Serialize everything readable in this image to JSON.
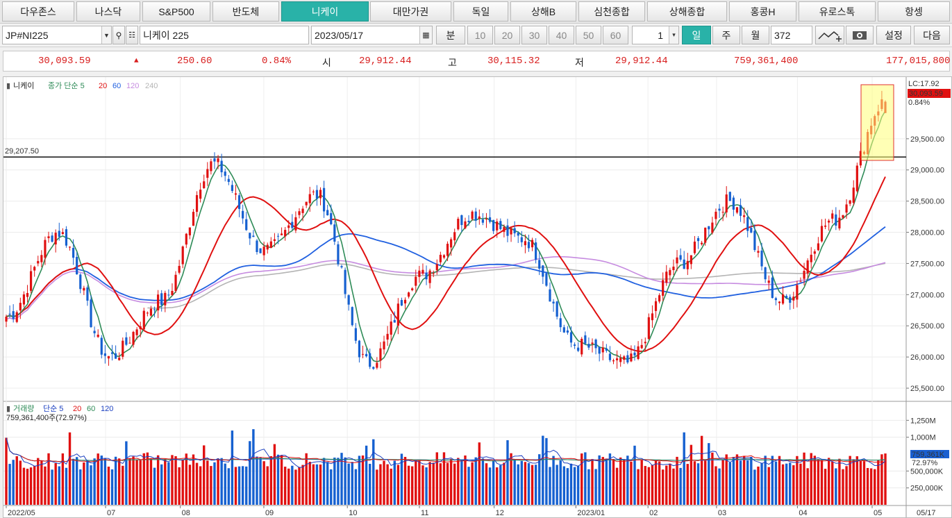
{
  "tabs": [
    "다우존스",
    "나스닥",
    "S&P500",
    "반도체",
    "니케이",
    "대만가권",
    "독일",
    "상해B",
    "심천종합",
    "상해종합",
    "홍콩H",
    "유로스톡",
    "항셍"
  ],
  "active_tab": "니케이",
  "toolbar": {
    "symbol": "JP#NI225",
    "name": "니케이 225",
    "date": "2023/05/17",
    "minute_label": "분",
    "intervals": [
      "10",
      "20",
      "30",
      "40",
      "50",
      "60"
    ],
    "period_value": "1",
    "day_label": "일",
    "week_label": "주",
    "month_label": "월",
    "count": "372",
    "settings_label": "설정",
    "next_label": "다음"
  },
  "quote": {
    "price": "30,093.59",
    "change_arrow": "▲",
    "change": "250.60",
    "change_pct": "0.84%",
    "open_label": "시",
    "open": "29,912.44",
    "high_label": "고",
    "high": "30,115.32",
    "low_label": "저",
    "low": "29,912.44",
    "volume": "759,361,400",
    "amount": "177,015,800"
  },
  "price_chart": {
    "legend_name": "니케이",
    "legend_ma": "종가 단순 5",
    "legend_periods": [
      "20",
      "60",
      "120",
      "240"
    ],
    "ref_line_label": "29,207.50",
    "lc_label": "LC:17.92",
    "last_price_label": "30,093.59",
    "last_pct_label": "0.84%",
    "y_ticks": [
      "29,500.00",
      "29,000.00",
      "28,500.00",
      "28,000.00",
      "27,500.00",
      "27,000.00",
      "26,500.00",
      "26,000.00",
      "25,500.00"
    ],
    "colors": {
      "up": "#e01010",
      "down": "#1560d0",
      "ma5": "#2e8b57",
      "ma20": "#e01010",
      "ma60": "#2060e0",
      "ma120": "#c68be0",
      "ma240": "#b4b4b4"
    }
  },
  "volume_chart": {
    "legend_name": "거래량",
    "legend_ma": "단순 5",
    "legend_periods": [
      "20",
      "60",
      "120"
    ],
    "value_label": "759,361,400주(72.97%)",
    "y_ticks": [
      "1,250M",
      "1,000M",
      "500,000K",
      "250,000K"
    ],
    "last_label": "759,361K",
    "last_pct": "72.97%"
  },
  "x_ticks": [
    "2022/05",
    "07",
    "08",
    "09",
    "10",
    "11",
    "12",
    "2023/01",
    "02",
    "03",
    "04",
    "05",
    "05/17"
  ],
  "chart_data": {
    "type": "candlestick",
    "title": "니케이",
    "x_range": [
      "2022/05",
      "2023/05/17"
    ],
    "ylim": [
      25300,
      30400
    ],
    "reference_line": 29207.5,
    "last": {
      "date": "2023/05/17",
      "open": 29912.44,
      "high": 30115.32,
      "low": 29912.44,
      "close": 30093.59,
      "volume": 759361400
    },
    "price_path": [
      {
        "date": "2022/05",
        "close": 26650
      },
      {
        "date": "2022/06 early",
        "close": 28000
      },
      {
        "date": "2022/06 late",
        "close": 26000
      },
      {
        "date": "2022/07",
        "close": 26900
      },
      {
        "date": "2022/08 mid",
        "close": 29100
      },
      {
        "date": "2022/09 early",
        "close": 27700
      },
      {
        "date": "2022/09 mid",
        "close": 28600
      },
      {
        "date": "2022/10 early",
        "close": 25900
      },
      {
        "date": "2022/10 late",
        "close": 27300
      },
      {
        "date": "2022/11 late",
        "close": 28300
      },
      {
        "date": "2022/12 mid",
        "close": 27900
      },
      {
        "date": "2022/12 late",
        "close": 26200
      },
      {
        "date": "2023/01 early",
        "close": 25900
      },
      {
        "date": "2023/02",
        "close": 27500
      },
      {
        "date": "2023/03 early",
        "close": 28500
      },
      {
        "date": "2023/03 mid",
        "close": 26900
      },
      {
        "date": "2023/04 mid",
        "close": 28200
      },
      {
        "date": "2023/05/17",
        "close": 30093.59
      }
    ],
    "volume_ylim": [
      0,
      1500000000
    ]
  }
}
